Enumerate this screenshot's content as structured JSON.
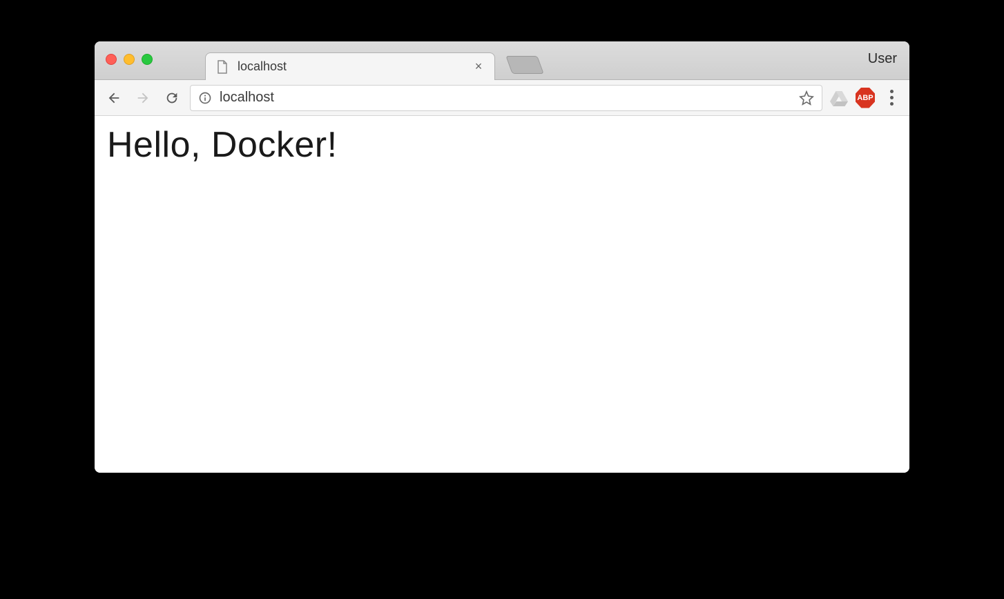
{
  "tab": {
    "title": "localhost",
    "close_glyph": "×"
  },
  "user_label": "User",
  "address": {
    "url": "localhost"
  },
  "extensions": {
    "abp_label": "ABP"
  },
  "page": {
    "heading": "Hello, Docker!"
  }
}
